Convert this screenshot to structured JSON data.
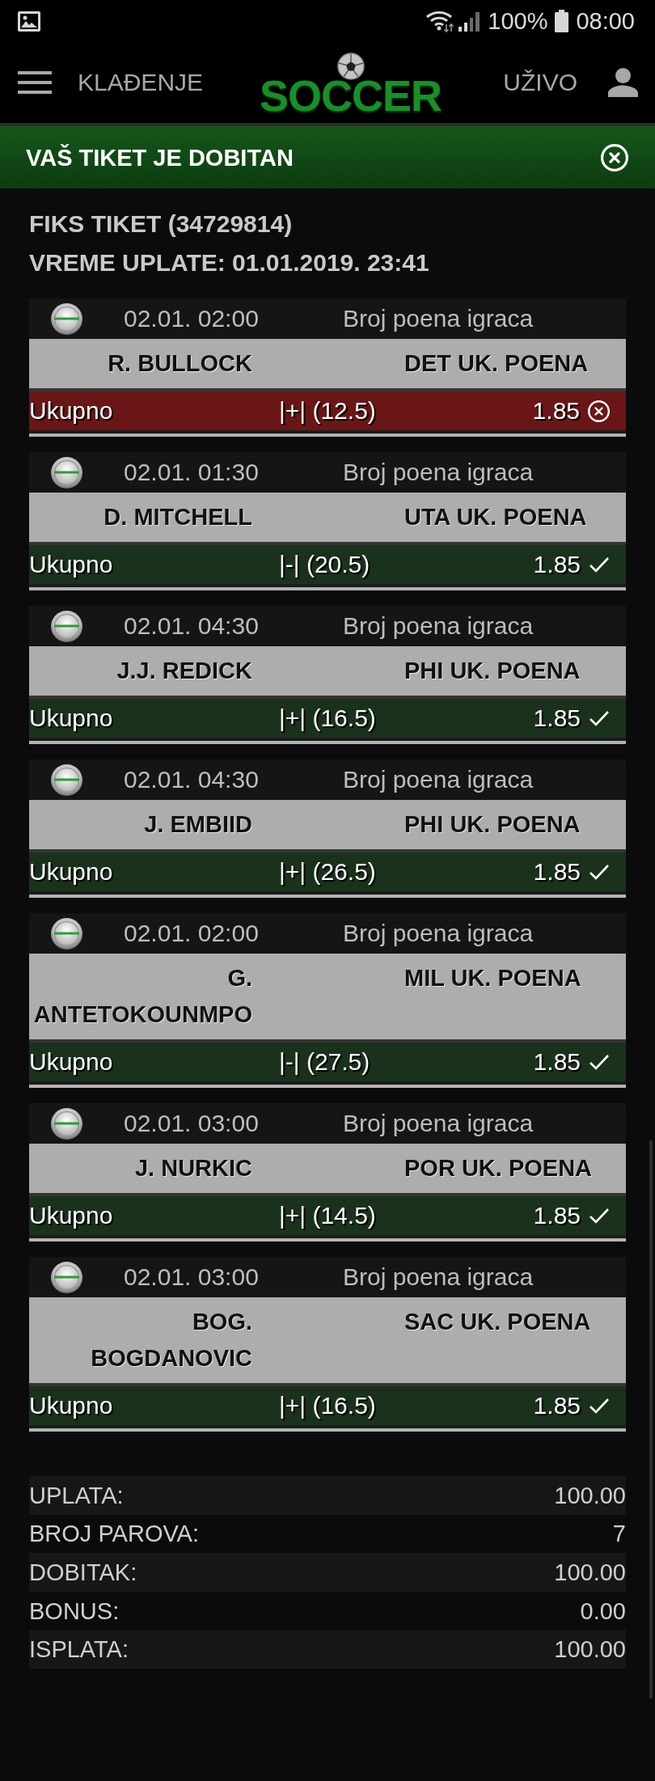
{
  "status_bar": {
    "battery_percent": "100%",
    "time": "08:00"
  },
  "app_bar": {
    "menu_label": "KLAĐENJE",
    "logo": "SOCCER",
    "live_label": "UŽIVO"
  },
  "banner": {
    "message": "VAŠ TIKET JE DOBITAN"
  },
  "ticket": {
    "title": "FIKS TIKET (34729814)",
    "paid_time": "VREME UPLATE: 01.01.2019. 23:41"
  },
  "bets": [
    {
      "datetime": "02.01. 02:00",
      "market": "Broj poena igraca",
      "player": "R. BULLOCK",
      "bet_type": "DET UK. POENA",
      "pick_label": "Ukupno",
      "pick": "|+| (12.5)",
      "odds": "1.85",
      "won": false
    },
    {
      "datetime": "02.01. 01:30",
      "market": "Broj poena igraca",
      "player": "D. MITCHELL",
      "bet_type": "UTA UK. POENA",
      "pick_label": "Ukupno",
      "pick": "|-| (20.5)",
      "odds": "1.85",
      "won": true
    },
    {
      "datetime": "02.01. 04:30",
      "market": "Broj poena igraca",
      "player": "J.J. REDICK",
      "bet_type": "PHI UK. POENA",
      "pick_label": "Ukupno",
      "pick": "|+| (16.5)",
      "odds": "1.85",
      "won": true
    },
    {
      "datetime": "02.01. 04:30",
      "market": "Broj poena igraca",
      "player": "J. EMBIID",
      "bet_type": "PHI UK. POENA",
      "pick_label": "Ukupno",
      "pick": "|+| (26.5)",
      "odds": "1.85",
      "won": true
    },
    {
      "datetime": "02.01. 02:00",
      "market": "Broj poena igraca",
      "player": "G. ANTETOKOUNMPO",
      "bet_type": "MIL UK. POENA",
      "pick_label": "Ukupno",
      "pick": "|-| (27.5)",
      "odds": "1.85",
      "won": true
    },
    {
      "datetime": "02.01. 03:00",
      "market": "Broj poena igraca",
      "player": "J. NURKIC",
      "bet_type": "POR UK. POENA",
      "pick_label": "Ukupno",
      "pick": "|+| (14.5)",
      "odds": "1.85",
      "won": true
    },
    {
      "datetime": "02.01. 03:00",
      "market": "Broj poena igraca",
      "player": "BOG. BOGDANOVIC",
      "bet_type": "SAC UK. POENA",
      "pick_label": "Ukupno",
      "pick": "|+| (16.5)",
      "odds": "1.85",
      "won": true
    }
  ],
  "summary": [
    {
      "label": "UPLATA:",
      "value": "100.00"
    },
    {
      "label": "BROJ PAROVA:",
      "value": "7"
    },
    {
      "label": "DOBITAK:",
      "value": "100.00"
    },
    {
      "label": "BONUS:",
      "value": "0.00"
    },
    {
      "label": "ISPLATA:",
      "value": "100.00"
    }
  ]
}
